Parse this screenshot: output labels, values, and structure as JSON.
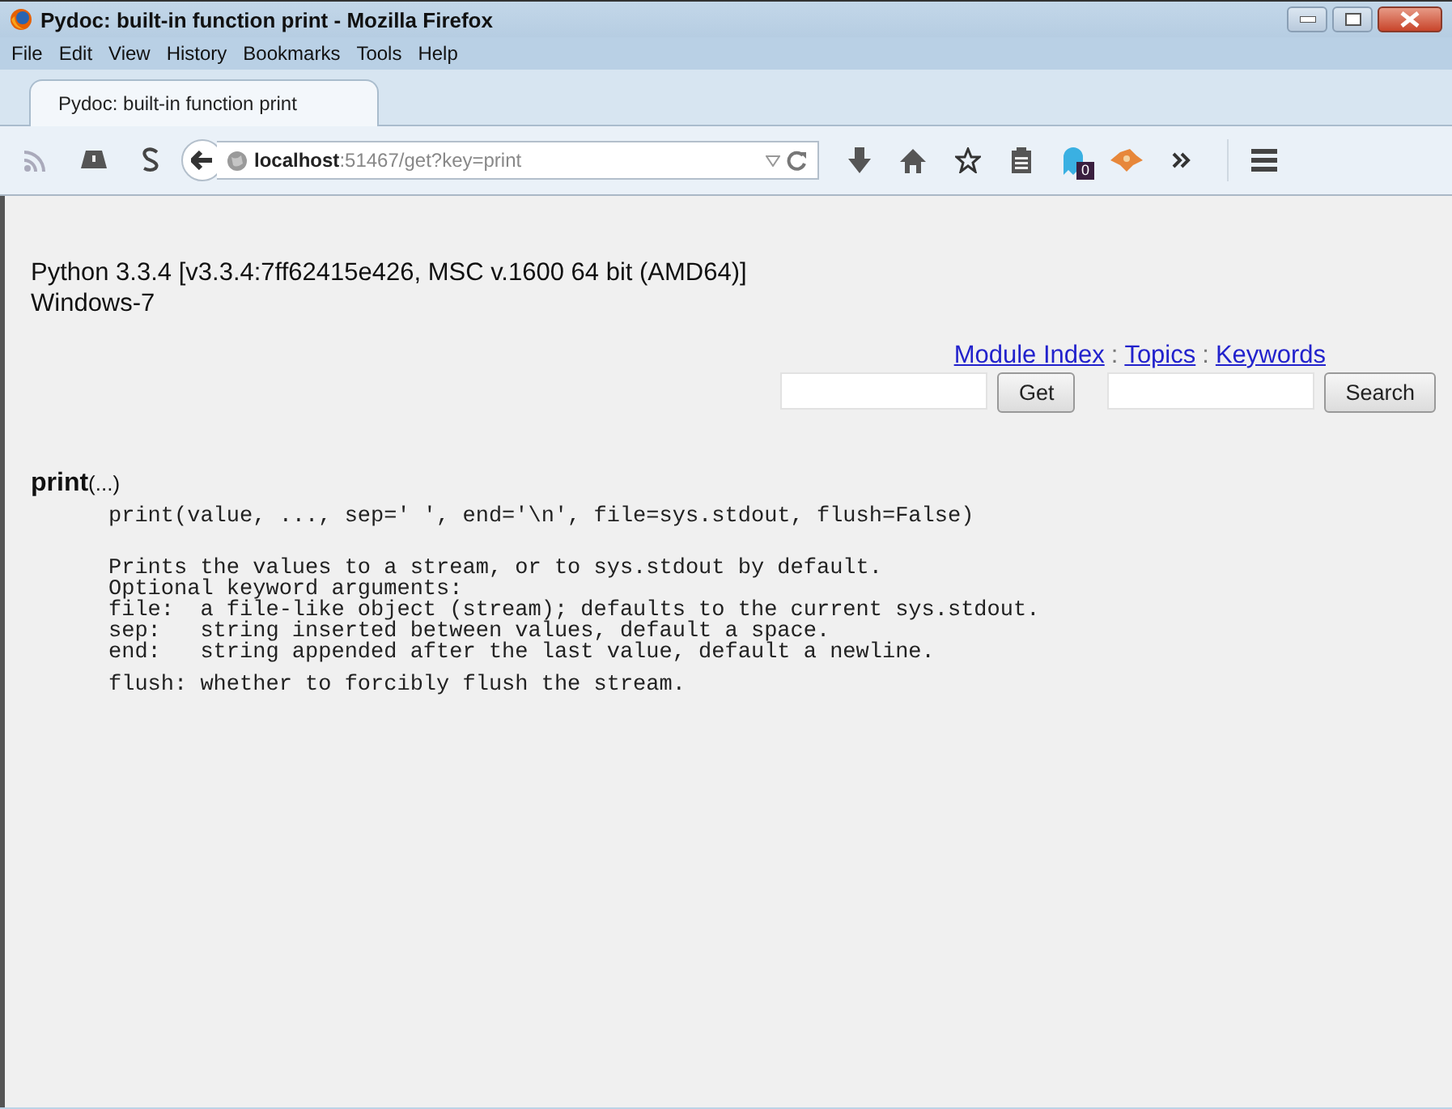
{
  "window": {
    "title": "Pydoc: built-in function print - Mozilla Firefox"
  },
  "menu": [
    "File",
    "Edit",
    "View",
    "History",
    "Bookmarks",
    "Tools",
    "Help"
  ],
  "tabs": [
    {
      "label": "Pydoc: built-in function print",
      "selected": true
    }
  ],
  "toolbar": {
    "url": "**localhost**:51467/get?key=print",
    "badge": "0"
  },
  "page": {
    "version_lines": [
      "Python 3.3.4 [v3.3.4:7ff62415e426, MSC v.1600 64 bit (AMD64)]",
      "Windows-7"
    ],
    "nav": [
      {
        "kind": "link",
        "text": "Module Index"
      },
      {
        "kind": "separator",
        "text": ":"
      },
      {
        "kind": "link",
        "text": "Topics"
      },
      {
        "kind": "separator",
        "text": ":"
      },
      {
        "kind": "link",
        "text": "Keywords"
      }
    ],
    "forms": [
      {
        "button": "Get"
      },
      {
        "button": "Search"
      }
    ],
    "heading": "**print**(...)",
    "doc_paragraphs": [
      [
        "print(value, ..., sep=' ', end='\\n', file=sys.stdout, flush=False)"
      ],
      [
        "Prints the values to a stream, or to sys.stdout by default.",
        "Optional keyword arguments:",
        "file:  a file-like object (stream); defaults to the current sys.stdout.",
        "sep:   string inserted between values, default a space.",
        "end:   string appended after the last value, default a newline."
      ],
      [
        "flush: whether to forcibly flush the stream."
      ]
    ]
  }
}
